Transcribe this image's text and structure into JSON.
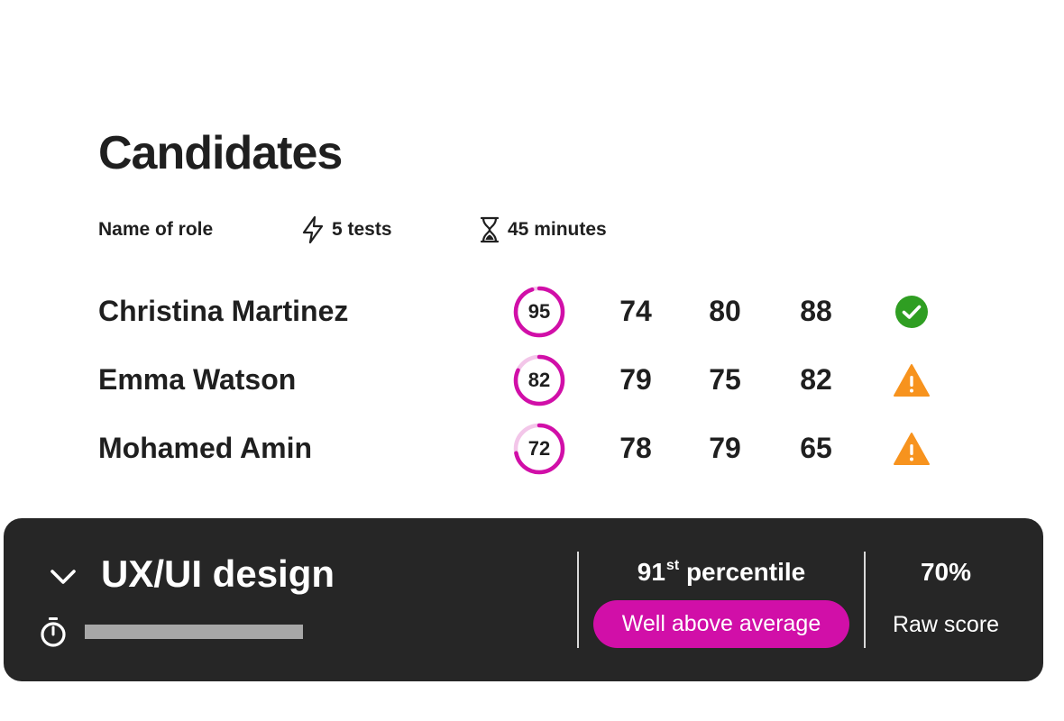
{
  "page": {
    "title": "Candidates",
    "meta": {
      "role": "Name of role",
      "tests": "5 tests",
      "duration": "45 minutes",
      "tests_icon": "lightning-icon",
      "duration_icon": "hourglass-icon"
    }
  },
  "candidates": [
    {
      "name": "Christina Martinez",
      "overall": "95",
      "overall_fraction": 0.95,
      "scores": [
        "74",
        "80",
        "88"
      ],
      "status": "passed",
      "status_icon": "check-circle-icon"
    },
    {
      "name": "Emma Watson",
      "overall": "82",
      "overall_fraction": 0.82,
      "scores": [
        "79",
        "75",
        "82"
      ],
      "status": "warning",
      "status_icon": "warning-triangle-icon"
    },
    {
      "name": "Mohamed Amin",
      "overall": "72",
      "overall_fraction": 0.72,
      "scores": [
        "78",
        "79",
        "65"
      ],
      "status": "warning",
      "status_icon": "warning-triangle-icon"
    }
  ],
  "test_panel": {
    "title": "UX/UI design",
    "percentile_number": "91",
    "percentile_suffix": "st",
    "percentile_word": "percentile",
    "rating": "Well above average",
    "raw_score": "70%",
    "raw_score_label": "Raw score",
    "expand_icon": "chevron-down-icon",
    "timer_icon": "stopwatch-icon"
  },
  "colors": {
    "accent": "#d10fa8",
    "ring_track": "#f3c6e9",
    "success": "#2f9e22",
    "warning": "#f7931e",
    "panel_bg": "#262626",
    "text": "#1f1f1f"
  }
}
